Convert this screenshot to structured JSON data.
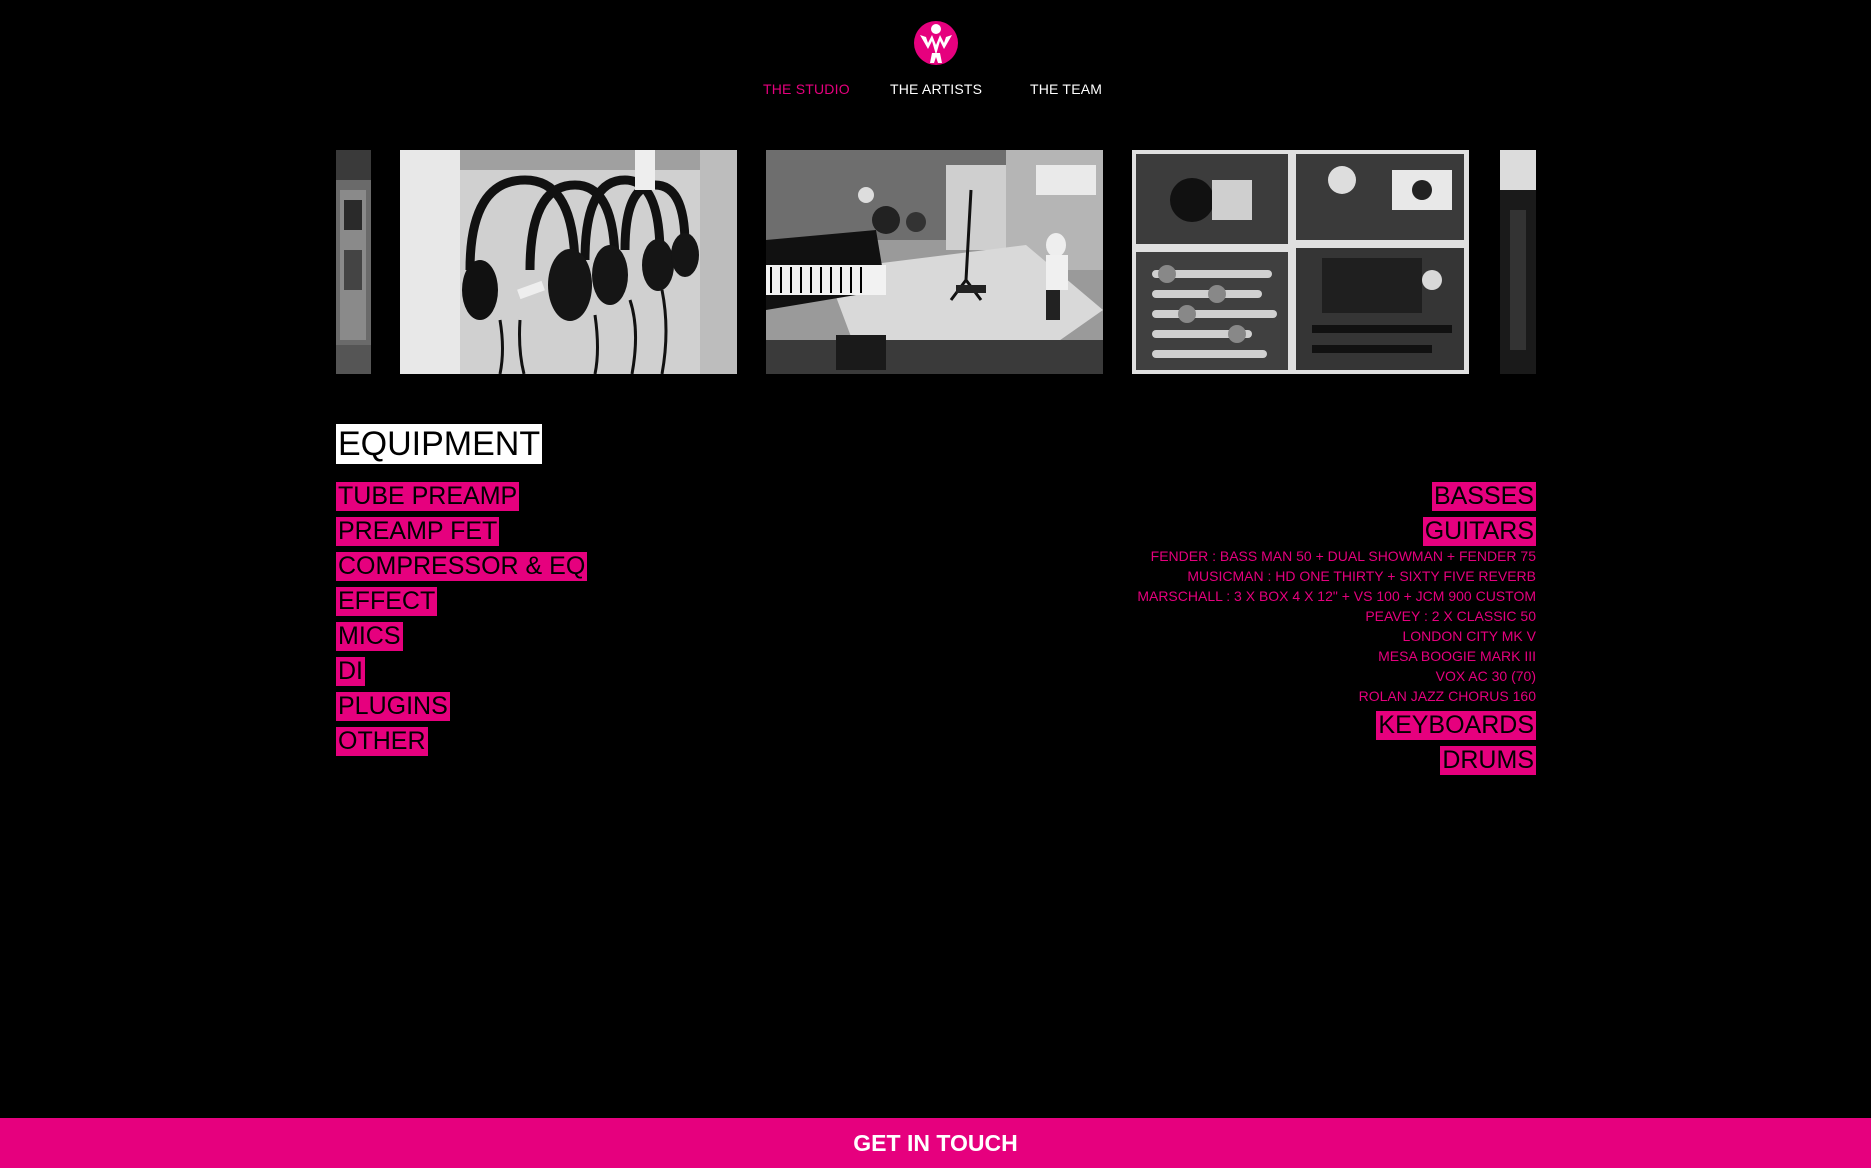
{
  "nav": {
    "items": [
      {
        "label": "THE STUDIO",
        "active": true
      },
      {
        "label": "THE ARTISTS",
        "active": false
      },
      {
        "label": "THE TEAM",
        "active": false
      }
    ]
  },
  "equipment": {
    "title": "EQUIPMENT",
    "left": [
      "TUBE PREAMP",
      "PREAMP FET",
      "COMPRESSOR & EQ",
      "EFFECT",
      "MICS",
      "DI",
      "PLUGINS",
      "OTHER"
    ],
    "right": {
      "basses": "BASSES",
      "guitars": "GUITARS",
      "guitar_items": [
        "FENDER : BASS MAN 50 + DUAL SHOWMAN + FENDER 75",
        "MUSICMAN : HD ONE THIRTY + SIXTY FIVE REVERB",
        "MARSCHALL : 3 X BOX 4 X 12\" + VS 100 + JCM 900 CUSTOM",
        "PEAVEY : 2 X CLASSIC 50",
        "LONDON CITY MK V",
        "MESA BOOGIE MARK III",
        "VOX AC 30 (70)",
        "ROLAN JAZZ CHORUS 160"
      ],
      "keyboards": "KEYBOARDS",
      "drums": "DRUMS"
    }
  },
  "footer": {
    "label": "GET IN TOUCH"
  },
  "colors": {
    "accent": "#e6007e",
    "background": "#000000"
  }
}
